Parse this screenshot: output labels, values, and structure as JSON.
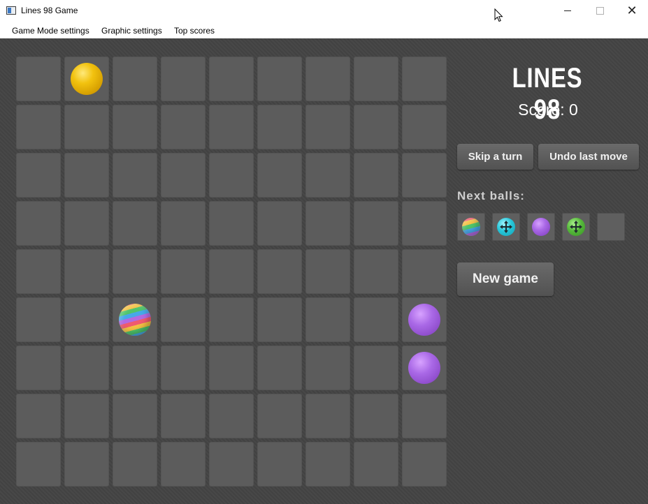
{
  "window": {
    "title": "Lines 98 Game",
    "controls": {
      "minimize_icon": "minimize-icon",
      "maximize_icon": "maximize-icon",
      "close_icon": "close-icon"
    }
  },
  "menu": [
    "Game Mode settings",
    "Graphic settings",
    "Top scores"
  ],
  "game": {
    "title": "LINES 98",
    "score_text": "Score: 0",
    "skip_label": "Skip a turn",
    "undo_label": "Undo last move",
    "next_label": "Next balls:",
    "new_game_label": "New game",
    "board_size": 9,
    "balls": [
      {
        "row": 0,
        "col": 1,
        "type": "yellow"
      },
      {
        "row": 5,
        "col": 2,
        "type": "rainbow"
      },
      {
        "row": 5,
        "col": 8,
        "type": "purple"
      },
      {
        "row": 6,
        "col": 8,
        "type": "purple"
      }
    ],
    "next_balls": [
      "rainbow",
      "cyan-arrows",
      "purple",
      "green-arrows",
      "empty"
    ]
  },
  "colors": {
    "background": "#444444",
    "cell": "#5c5c5c",
    "yellow": "#f2c20f",
    "purple": "#a968e6",
    "cyan": "#27c6d9",
    "green": "#55b83a"
  }
}
